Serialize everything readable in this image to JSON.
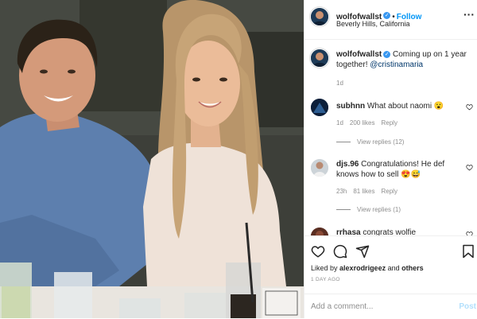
{
  "post": {
    "username": "wolfofwallst",
    "follow_label": "Follow",
    "location": "Beverly Hills, California",
    "separator": "•",
    "verified_glyph": "✓",
    "more_glyph": "···"
  },
  "caption": {
    "username": "wolfofwallst",
    "text": "Coming up on 1 year together!",
    "mention": "@cristinamaria",
    "age": "1d"
  },
  "comments": [
    {
      "username": "subhnn",
      "text": "What about naomi",
      "emoji": "😮",
      "age": "1d",
      "likes": "200 likes",
      "reply": "Reply",
      "view_replies": "View replies (12)"
    },
    {
      "username": "djs.96",
      "text": "Congratulations! He def knows how to sell",
      "emoji": "😍😅",
      "age": "23h",
      "likes": "81 likes",
      "reply": "Reply",
      "view_replies": "View replies (1)"
    },
    {
      "username": "rrhasa",
      "text": "congrats wolfie",
      "emoji": "",
      "age": "",
      "likes": "",
      "reply": "",
      "view_replies": ""
    }
  ],
  "actions": {
    "icons": [
      "heart-icon",
      "comment-icon",
      "share-icon",
      "bookmark-icon"
    ],
    "liked_by_prefix": "Liked by",
    "liked_by_user": "alexrodrigeez",
    "liked_by_suffix": "and",
    "liked_by_others": "others",
    "timestamp": "1 DAY AGO",
    "add_comment_placeholder": "Add a comment...",
    "post_label": "Post"
  },
  "colors": {
    "accent": "#0095f6",
    "verified": "#3897f0",
    "muted": "#8e8e8e",
    "border": "#efefef"
  }
}
